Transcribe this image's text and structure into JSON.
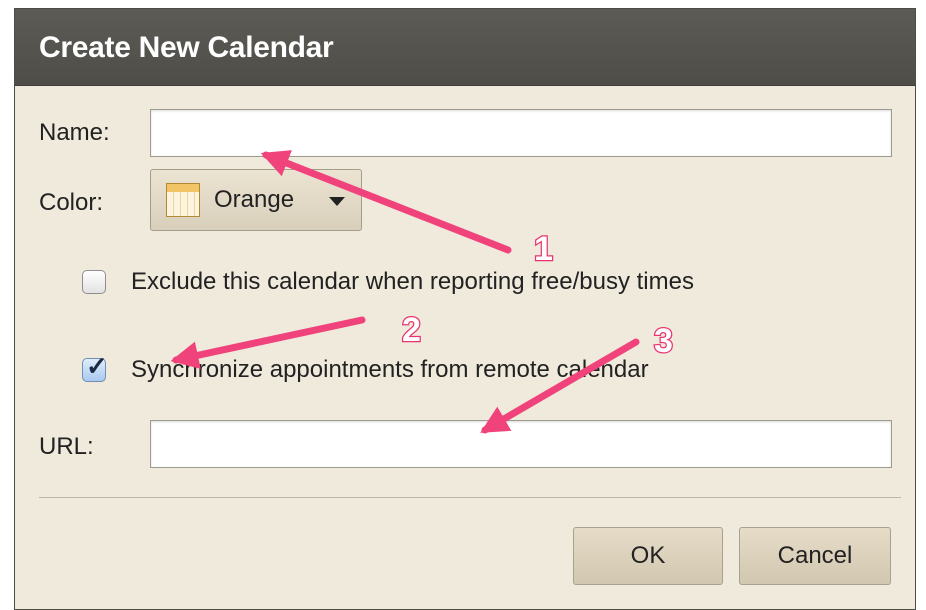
{
  "dialog": {
    "title": "Create New Calendar"
  },
  "form": {
    "name_label": "Name:",
    "name_value": "",
    "color_label": "Color:",
    "color_value": "Orange",
    "exclude_label": "Exclude this calendar when reporting free/busy times",
    "exclude_checked": false,
    "sync_label": "Synchronize appointments from remote calendar",
    "sync_checked": true,
    "url_label": "URL:",
    "url_value": ""
  },
  "buttons": {
    "ok_label": "OK",
    "cancel_label": "Cancel"
  },
  "annotations": [
    {
      "number": "1"
    },
    {
      "number": "2"
    },
    {
      "number": "3"
    }
  ],
  "colors": {
    "annotation_pink": "#f0437c",
    "dialog_background": "#f0eadc",
    "titlebar": "#55544f",
    "color_swatch": "#f3c465"
  },
  "icons": {
    "color_swatch": "calendar-swatch-icon",
    "dropdown": "caret-down-icon",
    "check": "checkmark-icon"
  }
}
